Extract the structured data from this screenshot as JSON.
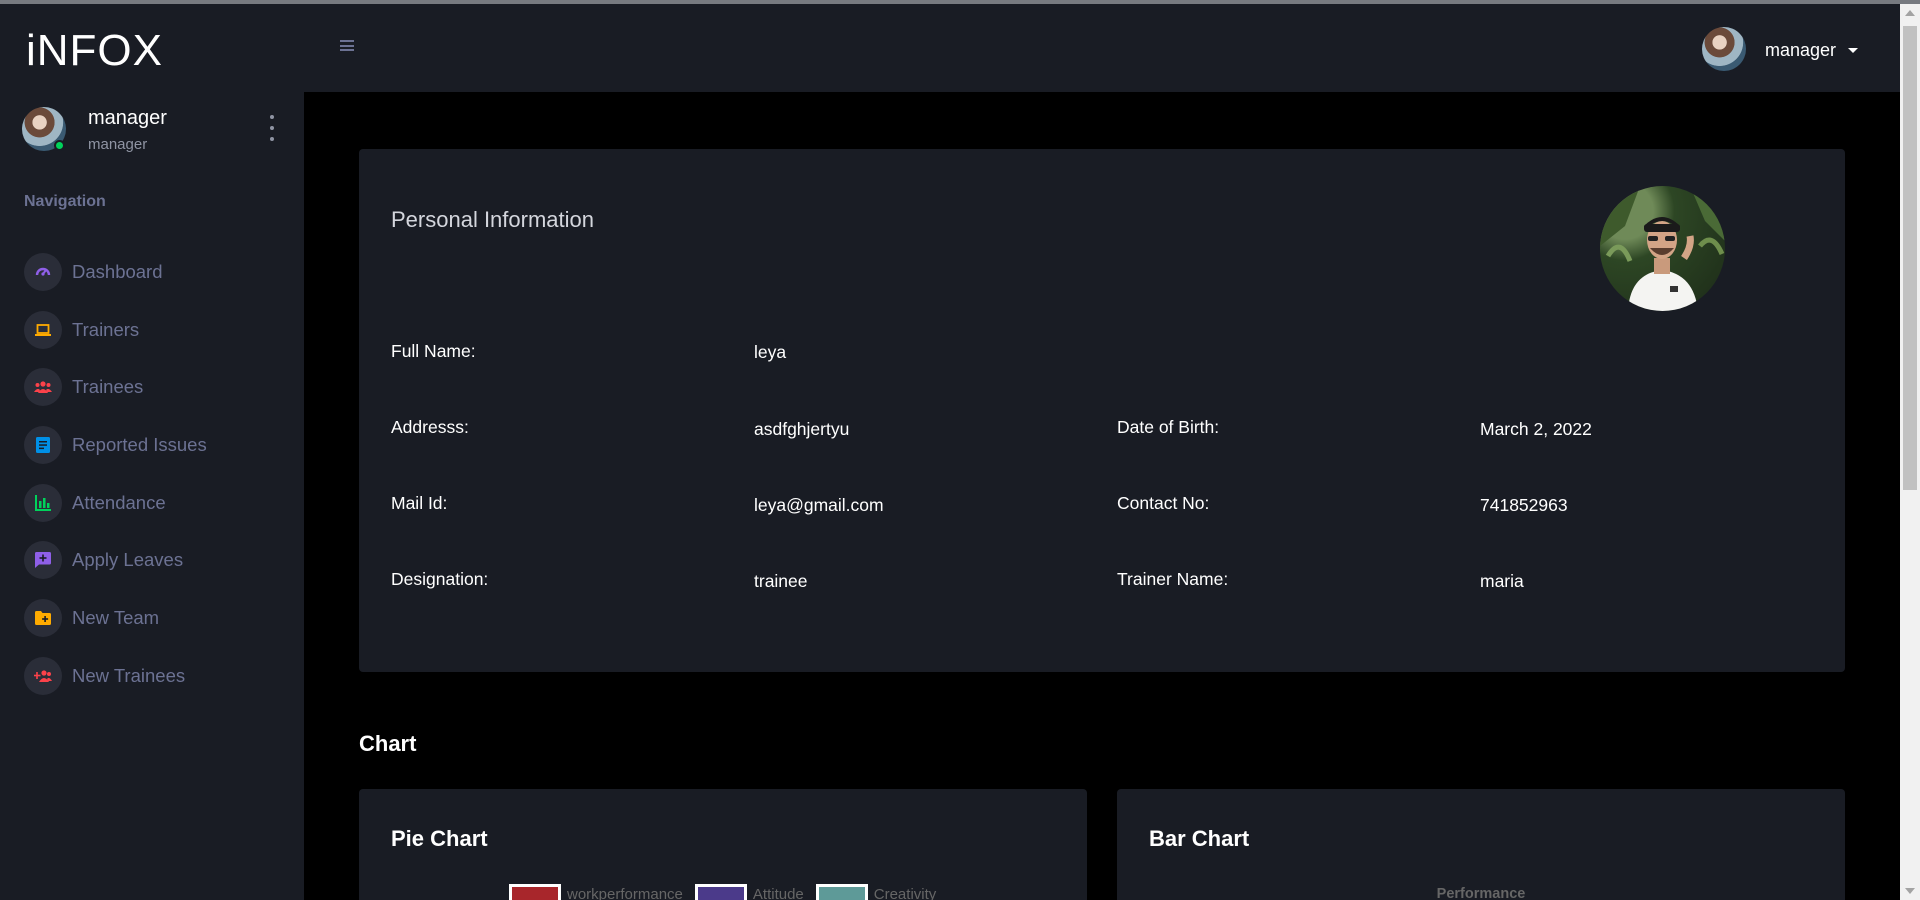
{
  "brand": "iNFOX",
  "sidebar": {
    "profile": {
      "name": "manager",
      "role": "manager"
    },
    "nav_heading": "Navigation",
    "items": [
      {
        "label": "Dashboard",
        "icon": "speedometer-icon",
        "color": "#8f5fe8"
      },
      {
        "label": "Trainers",
        "icon": "laptop-icon",
        "color": "#ffab00"
      },
      {
        "label": "Trainees",
        "icon": "users-icon",
        "color": "#fc424a"
      },
      {
        "label": "Reported Issues",
        "icon": "document-icon",
        "color": "#0090e7"
      },
      {
        "label": "Attendance",
        "icon": "bar-chart-icon",
        "color": "#00d25b"
      },
      {
        "label": "Apply Leaves",
        "icon": "message-plus-icon",
        "color": "#8f5fe8"
      },
      {
        "label": "New Team",
        "icon": "folder-plus-icon",
        "color": "#ffab00"
      },
      {
        "label": "New Trainees",
        "icon": "user-plus-icon",
        "color": "#fc424a"
      }
    ]
  },
  "navbar": {
    "user_name": "manager"
  },
  "personal": {
    "title": "Personal Information",
    "full_name": {
      "label": "Full Name:",
      "value": "leya"
    },
    "address": {
      "label": "Addresss:",
      "value": "asdfghjertyu"
    },
    "dob": {
      "label": "Date of Birth:",
      "value": "March 2, 2022"
    },
    "mail": {
      "label": "Mail Id:",
      "value": "leya@gmail.com"
    },
    "contact": {
      "label": "Contact No:",
      "value": "741852963"
    },
    "designation": {
      "label": "Designation:",
      "value": "trainee"
    },
    "trainer": {
      "label": "Trainer Name:",
      "value": "maria"
    }
  },
  "chart_section": {
    "title": "Chart",
    "pie_title": "Pie Chart",
    "bar_title": "Bar Chart",
    "pie_legend": [
      {
        "label": "workperformance",
        "color": "#a8262b"
      },
      {
        "label": "Attitude",
        "color": "#4b3a8a"
      },
      {
        "label": "Creativity",
        "color": "#5e9a98"
      }
    ],
    "bar_chart_title": "Performance"
  }
}
